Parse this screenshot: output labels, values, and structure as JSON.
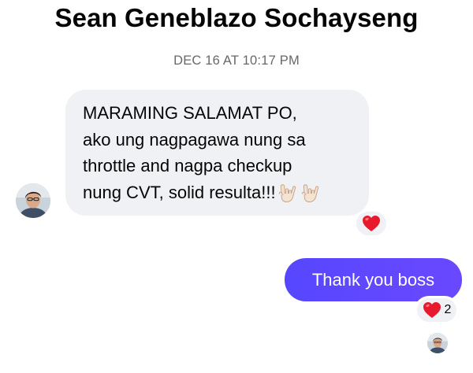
{
  "conversation": {
    "contact_name": "Sean Geneblazo Sochayseng",
    "timestamp": "DEC 16 AT 10:17 PM"
  },
  "messages": [
    {
      "direction": "incoming",
      "lines": [
        "MARAMING SALAMAT PO,",
        "ako ung nagpagawa nung sa",
        "throttle and nagpa checkup",
        "nung CVT, solid resulta!!!"
      ],
      "trailing_emoji": [
        "love-you-gesture-icon",
        "love-you-gesture-icon"
      ],
      "reaction": {
        "emoji": "heart-icon",
        "count": ""
      }
    },
    {
      "direction": "outgoing",
      "text": "Thank you boss",
      "reaction": {
        "emoji": "heart-icon",
        "count": "2"
      }
    }
  ],
  "colors": {
    "incoming_bubble": "#eff1f5",
    "outgoing_bubble": "#5b47ff",
    "timestamp_text": "#65676b",
    "heart": "#e8192c"
  }
}
